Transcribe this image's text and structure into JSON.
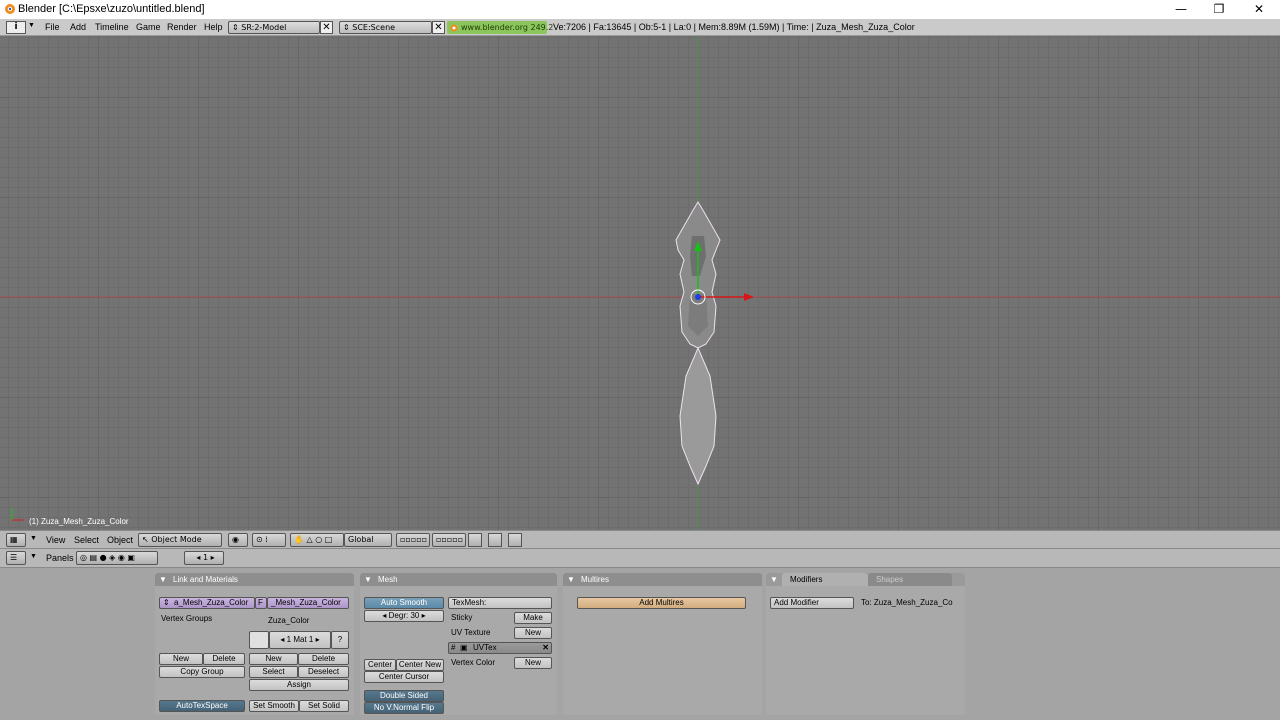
{
  "window": {
    "title": "Blender [C:\\Epsxe\\zuzo\\untitled.blend]",
    "minimize": "—",
    "maximize": "❐",
    "close": "✕"
  },
  "info_header": {
    "menus": [
      "File",
      "Add",
      "Timeline",
      "Game",
      "Render",
      "Help"
    ],
    "screen": "SR:2-Model",
    "scene": "SCE:Scene",
    "url": "www.blender.org 249.2",
    "stats": "Ve:7206 | Fa:13645 | Ob:5-1 | La:0  | Mem:8.89M (1.59M)  | Time: | Zuza_Mesh_Zuza_Color"
  },
  "viewport": {
    "object_label": "(1) Zuza_Mesh_Zuza_Color"
  },
  "view3d_header": {
    "menus": [
      "View",
      "Select",
      "Object"
    ],
    "mode": "Object Mode",
    "orientation": "Global"
  },
  "buttons_header": {
    "panels_label": "Panels",
    "frame": "1"
  },
  "panels": {
    "link_materials": {
      "title": "Link and Materials",
      "mesh_name": "a_Mesh_Zuza_Color",
      "f_label": "F",
      "object_name": "_Mesh_Zuza_Color",
      "vertex_groups": "Vertex Groups",
      "material_name": "Zuza_Color",
      "mat_slot": "1 Mat 1",
      "question": "?",
      "new": "New",
      "delete": "Delete",
      "copy_group": "Copy Group",
      "mat_new": "New",
      "mat_delete": "Delete",
      "select": "Select",
      "deselect": "Deselect",
      "assign": "Assign",
      "autotexspace": "AutoTexSpace",
      "set_smooth": "Set Smooth",
      "set_solid": "Set Solid"
    },
    "mesh": {
      "title": "Mesh",
      "auto_smooth": "Auto Smooth",
      "degr": "Degr: 30",
      "texmesh": "TexMesh:",
      "sticky": "Sticky",
      "make": "Make",
      "uv_texture": "UV Texture",
      "uv_new": "New",
      "uvtex": "UVTex",
      "vertex_color": "Vertex Color",
      "vc_new": "New",
      "center": "Center",
      "center_new": "Center New",
      "center_cursor": "Center Cursor",
      "double_sided": "Double Sided",
      "no_vnormal_flip": "No V.Normal Flip"
    },
    "multires": {
      "title": "Multires",
      "add": "Add Multires"
    },
    "modifiers": {
      "tab_modifiers": "Modifiers",
      "tab_shapes": "Shapes",
      "add": "Add Modifier",
      "to": "To: Zuza_Mesh_Zuza_Co"
    }
  }
}
